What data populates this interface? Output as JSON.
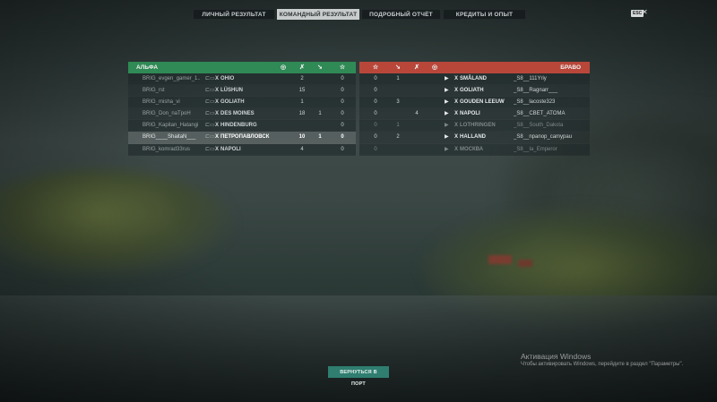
{
  "tabs": [
    {
      "label": "ЛИЧНЫЙ РЕЗУЛЬТАТ",
      "active": false
    },
    {
      "label": "КОМАНДНЫЙ РЕЗУЛЬТАТ",
      "active": true
    },
    {
      "label": "ПОДРОБНЫЙ ОТЧЁТ",
      "active": false
    },
    {
      "label": "КРЕДИТЫ И ОПЫТ",
      "active": false
    }
  ],
  "esc_label": "ESC",
  "close_glyph": "✕",
  "team_alpha": {
    "title": "АЛЬФА",
    "color": "#2f8a55",
    "rows": [
      {
        "player": "BRIG_evgen_gamer_1...",
        "tier": "X",
        "ship": "OHIO",
        "c1": "2",
        "c2": "",
        "c3": "0",
        "dead": false,
        "highlight": false
      },
      {
        "player": "BRIG_rst",
        "tier": "X",
        "ship": "LÜSHUN",
        "c1": "15",
        "c2": "",
        "c3": "0",
        "dead": false,
        "highlight": false
      },
      {
        "player": "BRIG_misha_vi",
        "tier": "X",
        "ship": "GOLIATH",
        "c1": "1",
        "c2": "",
        "c3": "0",
        "dead": false,
        "highlight": false
      },
      {
        "player": "BRIG_Don_naTpoH",
        "tier": "X",
        "ship": "DES MOINES",
        "c1": "18",
        "c2": "1",
        "c3": "0",
        "dead": false,
        "highlight": false
      },
      {
        "player": "BRIG_Kapitan_Hatangi",
        "tier": "X",
        "ship": "HINDENBURG",
        "c1": "",
        "c2": "",
        "c3": "0",
        "dead": false,
        "highlight": false
      },
      {
        "player": "BRIG____ShaitaN___",
        "tier": "X",
        "ship": "ПЕТРОПАВЛОВСК",
        "c1": "10",
        "c2": "1",
        "c3": "0",
        "dead": false,
        "highlight": true
      },
      {
        "player": "BRIG_komrad33rus",
        "tier": "X",
        "ship": "NAPOLI",
        "c1": "4",
        "c2": "",
        "c3": "0",
        "dead": false,
        "highlight": false
      }
    ]
  },
  "team_bravo": {
    "title": "БРАВО",
    "color": "#b8473a",
    "rows": [
      {
        "c3": "0",
        "c2": "1",
        "c1": "",
        "tier": "X",
        "ship": "SMÅLAND",
        "player": "_S8__111Yriy",
        "dead": false
      },
      {
        "c3": "0",
        "c2": "",
        "c1": "",
        "tier": "X",
        "ship": "GOLIATH",
        "player": "_S8__Ragnarr___",
        "dead": false
      },
      {
        "c3": "0",
        "c2": "3",
        "c1": "",
        "tier": "X",
        "ship": "GOUDEN LEEUW",
        "player": "_S8__lacoste323",
        "dead": false
      },
      {
        "c3": "0",
        "c2": "",
        "c1": "4",
        "tier": "X",
        "ship": "NAPOLI",
        "player": "_S8__CBET_ATOMA",
        "dead": false
      },
      {
        "c3": "0",
        "c2": "1",
        "c1": "",
        "tier": "X",
        "ship": "LOTHRINGEN",
        "player": "_S8__South_Dakota",
        "dead": true
      },
      {
        "c3": "0",
        "c2": "2",
        "c1": "",
        "tier": "X",
        "ship": "HALLAND",
        "player": "_S8__npanop_camypau",
        "dead": false
      },
      {
        "c3": "0",
        "c2": "",
        "c1": "",
        "tier": "X",
        "ship": "МОСКВА",
        "player": "_S8__Ia_Emperor",
        "dead": true
      }
    ]
  },
  "return_button": "ВЕРНУТЬСЯ В ПОРТ",
  "watermark": {
    "line1": "Активация Windows",
    "line2": "Чтобы активировать Windows, перейдите в раздел \"Параметры\"."
  }
}
